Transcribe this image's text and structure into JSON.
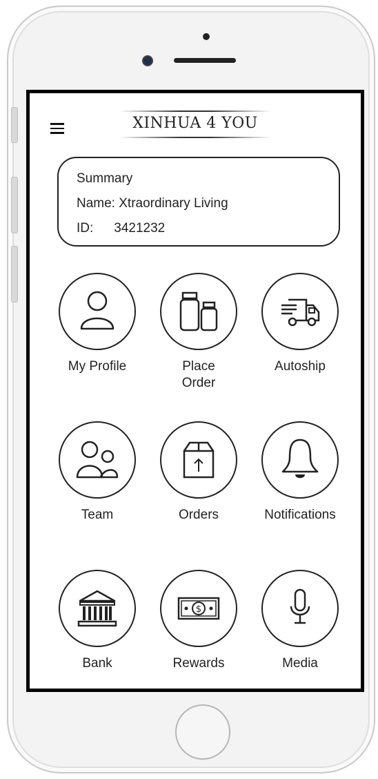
{
  "app": {
    "logo_text": "XINHUA 4 YOU"
  },
  "summary": {
    "heading": "Summary",
    "name_line": "Name: Xtraordinary Living",
    "id_label": "ID:",
    "id_value": "3421232"
  },
  "tiles": [
    {
      "label": "My Profile",
      "icon": "person-icon"
    },
    {
      "label": "Place\nOrder",
      "icon": "bottles-icon"
    },
    {
      "label": "Autoship",
      "icon": "delivery-truck-icon"
    },
    {
      "label": "Team",
      "icon": "team-icon"
    },
    {
      "label": "Orders",
      "icon": "package-icon"
    },
    {
      "label": "Notifications",
      "icon": "bell-icon"
    },
    {
      "label": "Bank",
      "icon": "bank-icon"
    },
    {
      "label": "Rewards",
      "icon": "money-bill-icon"
    },
    {
      "label": "Media",
      "icon": "microphone-icon"
    }
  ]
}
